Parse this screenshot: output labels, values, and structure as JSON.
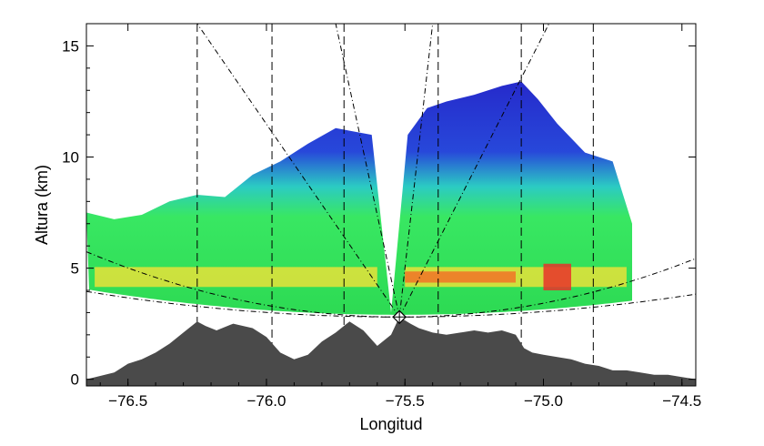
{
  "chart_data": {
    "type": "area",
    "xlabel": "Longitud",
    "ylabel": "Altura (km)",
    "xlim": [
      -76.65,
      -74.45
    ],
    "ylim": [
      -0.3,
      16.0
    ],
    "x_ticks": [
      {
        "value": -76.5,
        "label": "−76.5"
      },
      {
        "value": -76.0,
        "label": "−76.0"
      },
      {
        "value": -75.5,
        "label": "−75.5"
      },
      {
        "value": -75.0,
        "label": "−75.0"
      },
      {
        "value": -74.5,
        "label": "−74.5"
      }
    ],
    "y_ticks": [
      {
        "value": 0,
        "label": "0"
      },
      {
        "value": 5,
        "label": "5"
      },
      {
        "value": 10,
        "label": "10"
      },
      {
        "value": 15,
        "label": "15"
      }
    ],
    "grid": false,
    "radar": {
      "lon": -75.52,
      "alt": 2.8
    },
    "terrain": {
      "x": [
        -76.65,
        -76.55,
        -76.5,
        -76.45,
        -76.4,
        -76.35,
        -76.3,
        -76.25,
        -76.22,
        -76.18,
        -76.12,
        -76.05,
        -76.0,
        -75.95,
        -75.9,
        -75.85,
        -75.8,
        -75.75,
        -75.7,
        -75.65,
        -75.6,
        -75.55,
        -75.52,
        -75.48,
        -75.45,
        -75.4,
        -75.35,
        -75.3,
        -75.25,
        -75.2,
        -75.15,
        -75.1,
        -75.07,
        -75.04,
        -75.0,
        -74.95,
        -74.9,
        -74.85,
        -74.8,
        -74.75,
        -74.7,
        -74.65,
        -74.6,
        -74.55,
        -74.5,
        -74.45
      ],
      "y": [
        0.0,
        0.3,
        0.7,
        0.9,
        1.2,
        1.6,
        2.1,
        2.6,
        2.4,
        2.2,
        2.5,
        2.3,
        1.9,
        1.2,
        0.9,
        1.1,
        1.7,
        2.1,
        2.6,
        2.2,
        1.5,
        2.0,
        2.8,
        2.5,
        2.3,
        2.1,
        2.0,
        2.1,
        2.2,
        2.1,
        2.2,
        2.0,
        1.4,
        1.2,
        1.1,
        1.0,
        0.9,
        0.7,
        0.6,
        0.4,
        0.4,
        0.3,
        0.2,
        0.2,
        0.1,
        0.0
      ]
    },
    "echo_top": {
      "x": [
        -76.65,
        -76.55,
        -76.45,
        -76.35,
        -76.25,
        -76.15,
        -76.05,
        -75.95,
        -75.85,
        -75.75,
        -75.62,
        -75.55,
        -75.49,
        -75.42,
        -75.35,
        -75.25,
        -75.15,
        -75.08,
        -75.02,
        -74.95,
        -74.85,
        -74.75,
        -74.68
      ],
      "y": [
        7.5,
        7.2,
        7.4,
        8.0,
        8.3,
        8.2,
        9.2,
        9.8,
        10.6,
        11.3,
        11.0,
        3.0,
        11.0,
        12.2,
        12.5,
        12.8,
        13.2,
        13.4,
        12.6,
        11.5,
        10.2,
        9.8,
        7.0
      ]
    },
    "bright_band_alt": 4.6,
    "range_lines_x": [
      -76.25,
      -75.98,
      -75.72,
      -75.38,
      -75.08,
      -74.82
    ]
  }
}
